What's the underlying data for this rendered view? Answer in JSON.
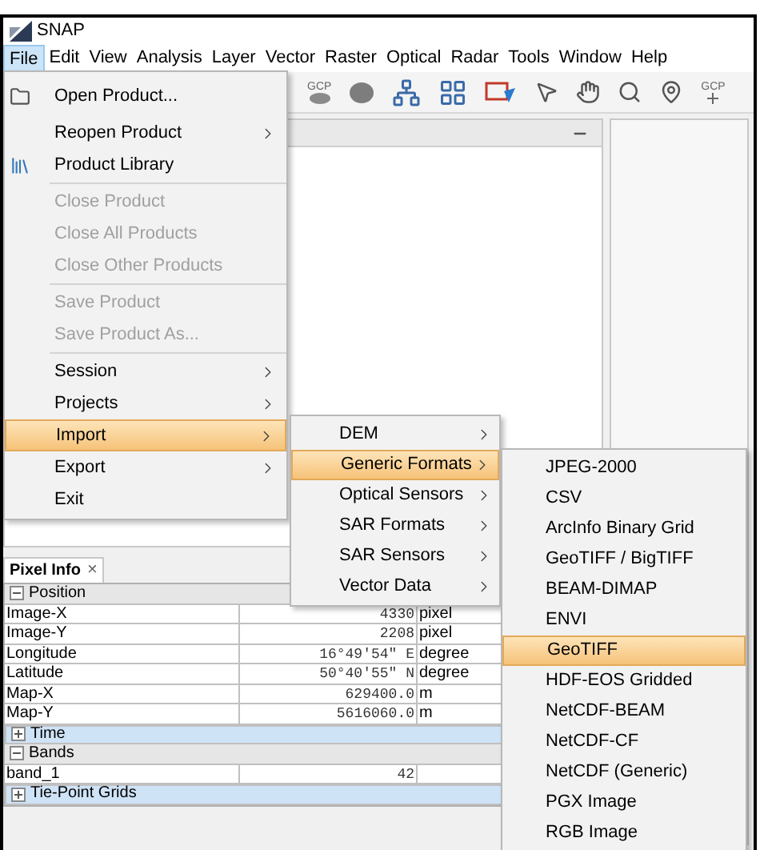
{
  "window": {
    "title": "SNAP"
  },
  "menu_bar": [
    {
      "label": "File",
      "selected": true
    },
    {
      "label": "Edit",
      "selected": false
    },
    {
      "label": "View",
      "selected": false
    },
    {
      "label": "Analysis",
      "selected": false
    },
    {
      "label": "Layer",
      "selected": false
    },
    {
      "label": "Vector",
      "selected": false
    },
    {
      "label": "Raster",
      "selected": false
    },
    {
      "label": "Optical",
      "selected": false
    },
    {
      "label": "Radar",
      "selected": false
    },
    {
      "label": "Tools",
      "selected": false
    },
    {
      "label": "Window",
      "selected": false
    },
    {
      "label": "Help",
      "selected": false
    }
  ],
  "toolbar": [
    {
      "kind": "gcp",
      "label": "GCP"
    },
    {
      "kind": "blob"
    },
    {
      "kind": "graph"
    },
    {
      "kind": "batch"
    },
    {
      "kind": "chart"
    },
    {
      "kind": "pointer"
    },
    {
      "kind": "hand"
    },
    {
      "kind": "zoom"
    },
    {
      "kind": "pin"
    },
    {
      "kind": "gcp-add",
      "label": "GCP"
    }
  ],
  "file_menu": {
    "groups": [
      [
        {
          "label": "Open Product...",
          "disabled": false,
          "submenu": false,
          "selected": false
        },
        {
          "label": "Reopen Product",
          "disabled": false,
          "submenu": true,
          "selected": false
        },
        {
          "label": "Product Library",
          "disabled": false,
          "submenu": false,
          "selected": false
        }
      ],
      [
        {
          "label": "Close Product",
          "disabled": true,
          "submenu": false,
          "selected": false
        },
        {
          "label": "Close All Products",
          "disabled": true,
          "submenu": false,
          "selected": false
        },
        {
          "label": "Close Other Products",
          "disabled": true,
          "submenu": false,
          "selected": false
        }
      ],
      [
        {
          "label": "Save Product",
          "disabled": true,
          "submenu": false,
          "selected": false
        },
        {
          "label": "Save Product As...",
          "disabled": true,
          "submenu": false,
          "selected": false
        }
      ],
      [
        {
          "label": "Session",
          "disabled": false,
          "submenu": true,
          "selected": false
        },
        {
          "label": "Projects",
          "disabled": false,
          "submenu": true,
          "selected": false
        },
        {
          "label": "Import",
          "disabled": false,
          "submenu": true,
          "selected": true
        },
        {
          "label": "Export",
          "disabled": false,
          "submenu": true,
          "selected": false
        },
        {
          "label": "Exit",
          "disabled": false,
          "submenu": false,
          "selected": false
        }
      ]
    ]
  },
  "import_menu": [
    {
      "label": "DEM",
      "submenu": true,
      "selected": false
    },
    {
      "label": "Generic Formats",
      "submenu": true,
      "selected": true
    },
    {
      "label": "Optical Sensors",
      "submenu": true,
      "selected": false
    },
    {
      "label": "SAR Formats",
      "submenu": true,
      "selected": false
    },
    {
      "label": "SAR Sensors",
      "submenu": true,
      "selected": false
    },
    {
      "label": "Vector Data",
      "submenu": true,
      "selected": false
    }
  ],
  "generic_formats_menu": [
    {
      "label": "JPEG-2000",
      "selected": false
    },
    {
      "label": "CSV",
      "selected": false
    },
    {
      "label": "ArcInfo Binary Grid",
      "selected": false
    },
    {
      "label": "GeoTIFF / BigTIFF",
      "selected": false
    },
    {
      "label": "BEAM-DIMAP",
      "selected": false
    },
    {
      "label": "ENVI",
      "selected": false
    },
    {
      "label": "GeoTIFF",
      "selected": true
    },
    {
      "label": "HDF-EOS Gridded",
      "selected": false
    },
    {
      "label": "NetCDF-BEAM",
      "selected": false
    },
    {
      "label": "NetCDF-CF",
      "selected": false
    },
    {
      "label": "NetCDF (Generic)",
      "selected": false
    },
    {
      "label": "PGX Image",
      "selected": false
    },
    {
      "label": "RGB Image",
      "selected": false
    }
  ],
  "pixel_info": {
    "tab": {
      "label": "Pixel Info",
      "close": "×"
    },
    "rows": [
      {
        "kind": "section",
        "label": "Position",
        "expanded": true
      },
      {
        "kind": "value",
        "name": "Image-X",
        "value": "4330",
        "unit": "pixel"
      },
      {
        "kind": "value",
        "name": "Image-Y",
        "value": "2208",
        "unit": "pixel"
      },
      {
        "kind": "value",
        "name": "Longitude",
        "value": "16°49'54\" E",
        "unit": "degree"
      },
      {
        "kind": "value",
        "name": "Latitude",
        "value": "50°40'55\" N",
        "unit": "degree"
      },
      {
        "kind": "value",
        "name": "Map-X",
        "value": "629400.0",
        "unit": "m"
      },
      {
        "kind": "value",
        "name": "Map-Y",
        "value": "5616060.0",
        "unit": "m"
      },
      {
        "kind": "section",
        "label": "Time",
        "expanded": false
      },
      {
        "kind": "section",
        "label": "Bands",
        "expanded": true
      },
      {
        "kind": "value",
        "name": "band_1",
        "value": "42"
      },
      {
        "kind": "section",
        "label": "Tie-Point Grids",
        "expanded": false
      }
    ]
  }
}
